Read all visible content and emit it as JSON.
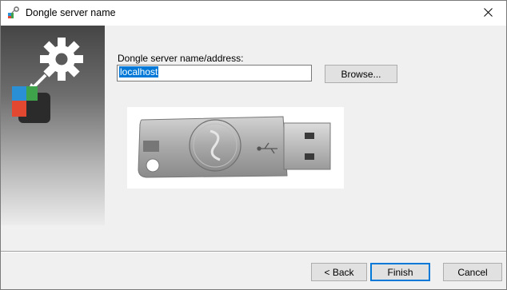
{
  "window": {
    "title": "Dongle server name",
    "title_icon": "gear-plug-icon",
    "close_icon": "close-icon"
  },
  "side_panel": {
    "logo_icon": "dongle-server-logo-icon",
    "colors": {
      "blue": "#2b8fd6",
      "red": "#e2472f",
      "green": "#3ea34a",
      "dark": "#2b2b2b"
    }
  },
  "form": {
    "label": "Dongle server name/address:",
    "input_value": "localhost",
    "browse_label": "Browse..."
  },
  "illustration": {
    "icon": "usb-dongle-icon"
  },
  "footer": {
    "back_label": "< Back",
    "finish_label": "Finish",
    "cancel_label": "Cancel"
  },
  "colors": {
    "selection": "#0078d7",
    "dialog_bg": "#f0f0f0"
  }
}
